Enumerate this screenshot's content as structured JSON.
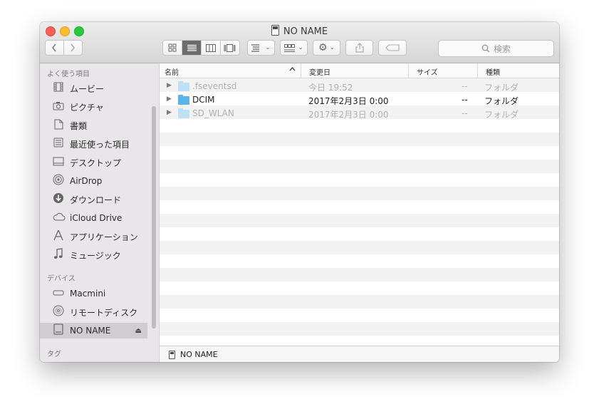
{
  "window": {
    "title": "NO NAME"
  },
  "toolbar": {
    "view_menu_icon": "list-options-icon",
    "arrange_icon": "grid-arrange-icon",
    "action_icon": "gear-icon",
    "share_icon": "share-icon",
    "tag_icon": "tag-icon",
    "dropdown_arrow": "⌄",
    "search_placeholder": "検索"
  },
  "sidebar": {
    "favorites_header": "よく使う項目",
    "favorites": [
      {
        "label": "ムービー",
        "icon": "movies-icon"
      },
      {
        "label": "ピクチャ",
        "icon": "pictures-icon"
      },
      {
        "label": "書類",
        "icon": "documents-icon"
      },
      {
        "label": "最近使った項目",
        "icon": "recents-icon"
      },
      {
        "label": "デスクトップ",
        "icon": "desktop-icon"
      },
      {
        "label": "AirDrop",
        "icon": "airdrop-icon"
      },
      {
        "label": "ダウンロード",
        "icon": "downloads-icon"
      },
      {
        "label": "iCloud Drive",
        "icon": "icloud-icon"
      },
      {
        "label": "アプリケーション",
        "icon": "applications-icon"
      },
      {
        "label": "ミュージック",
        "icon": "music-icon"
      }
    ],
    "devices_header": "デバイス",
    "devices": [
      {
        "label": "Macmini",
        "icon": "mac-mini-icon"
      },
      {
        "label": "リモートディスク",
        "icon": "remote-disc-icon"
      },
      {
        "label": "NO NAME",
        "icon": "drive-icon",
        "selected": true
      }
    ],
    "tags_header": "タグ"
  },
  "columns": {
    "name": "名前",
    "modified": "変更日",
    "size": "サイズ",
    "kind": "種類"
  },
  "files": [
    {
      "name": ".fseventsd",
      "date": "今日 19:52",
      "size": "--",
      "kind": "フォルダ",
      "hidden": true
    },
    {
      "name": "DCIM",
      "date": "2017年2月3日 0:00",
      "size": "--",
      "kind": "フォルダ",
      "hidden": false
    },
    {
      "name": "SD_WLAN",
      "date": "2017年2月3日 0:00",
      "size": "--",
      "kind": "フォルダ",
      "hidden": true
    }
  ],
  "pathbar": {
    "label": "NO NAME"
  },
  "colors": {
    "accent_folder": "#5ab4e8",
    "sidebar_bg": "#e8e6e8",
    "close": "#fc5f57",
    "minimize": "#fdbc2e",
    "zoom": "#28c840"
  }
}
